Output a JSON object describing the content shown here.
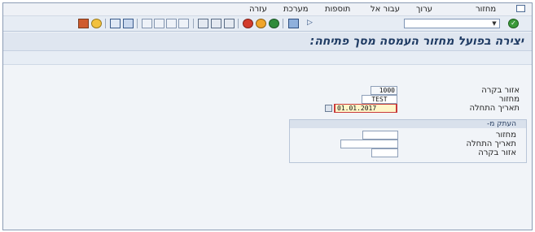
{
  "menu": {
    "items": [
      "מחזור",
      "ערוך",
      "עבור אל",
      "תוספות",
      "מערכת",
      "עזרה"
    ]
  },
  "toolbar": {
    "command_field_value": "",
    "icons": [
      "enter-icon",
      "save-icon",
      "back-icon",
      "exit-icon",
      "cancel-icon",
      "print-icon",
      "find-icon",
      "find-next-icon",
      "first-page-icon",
      "prev-page-icon",
      "next-page-icon",
      "last-page-icon",
      "new-session-icon",
      "shortcut-icon",
      "help-icon",
      "customize-layout-icon"
    ]
  },
  "title": "יצירה בפועל מחזור העמסה מסך פתיחה:",
  "form": {
    "purchasing_area_label": "אזור בקרה",
    "purchasing_area_value": "1000",
    "cycle_label": "מחזור",
    "cycle_value": "TEST",
    "start_date_label": "תאריך התחלה",
    "start_date_value": "01.01.2017"
  },
  "copy_group": {
    "title": "העתק מ-",
    "cycle_label": "מחזור",
    "cycle_value": "",
    "start_date_label": "תאריך התחלה",
    "start_date_value": "",
    "area_label": "אזור בקרה",
    "area_value": ""
  }
}
